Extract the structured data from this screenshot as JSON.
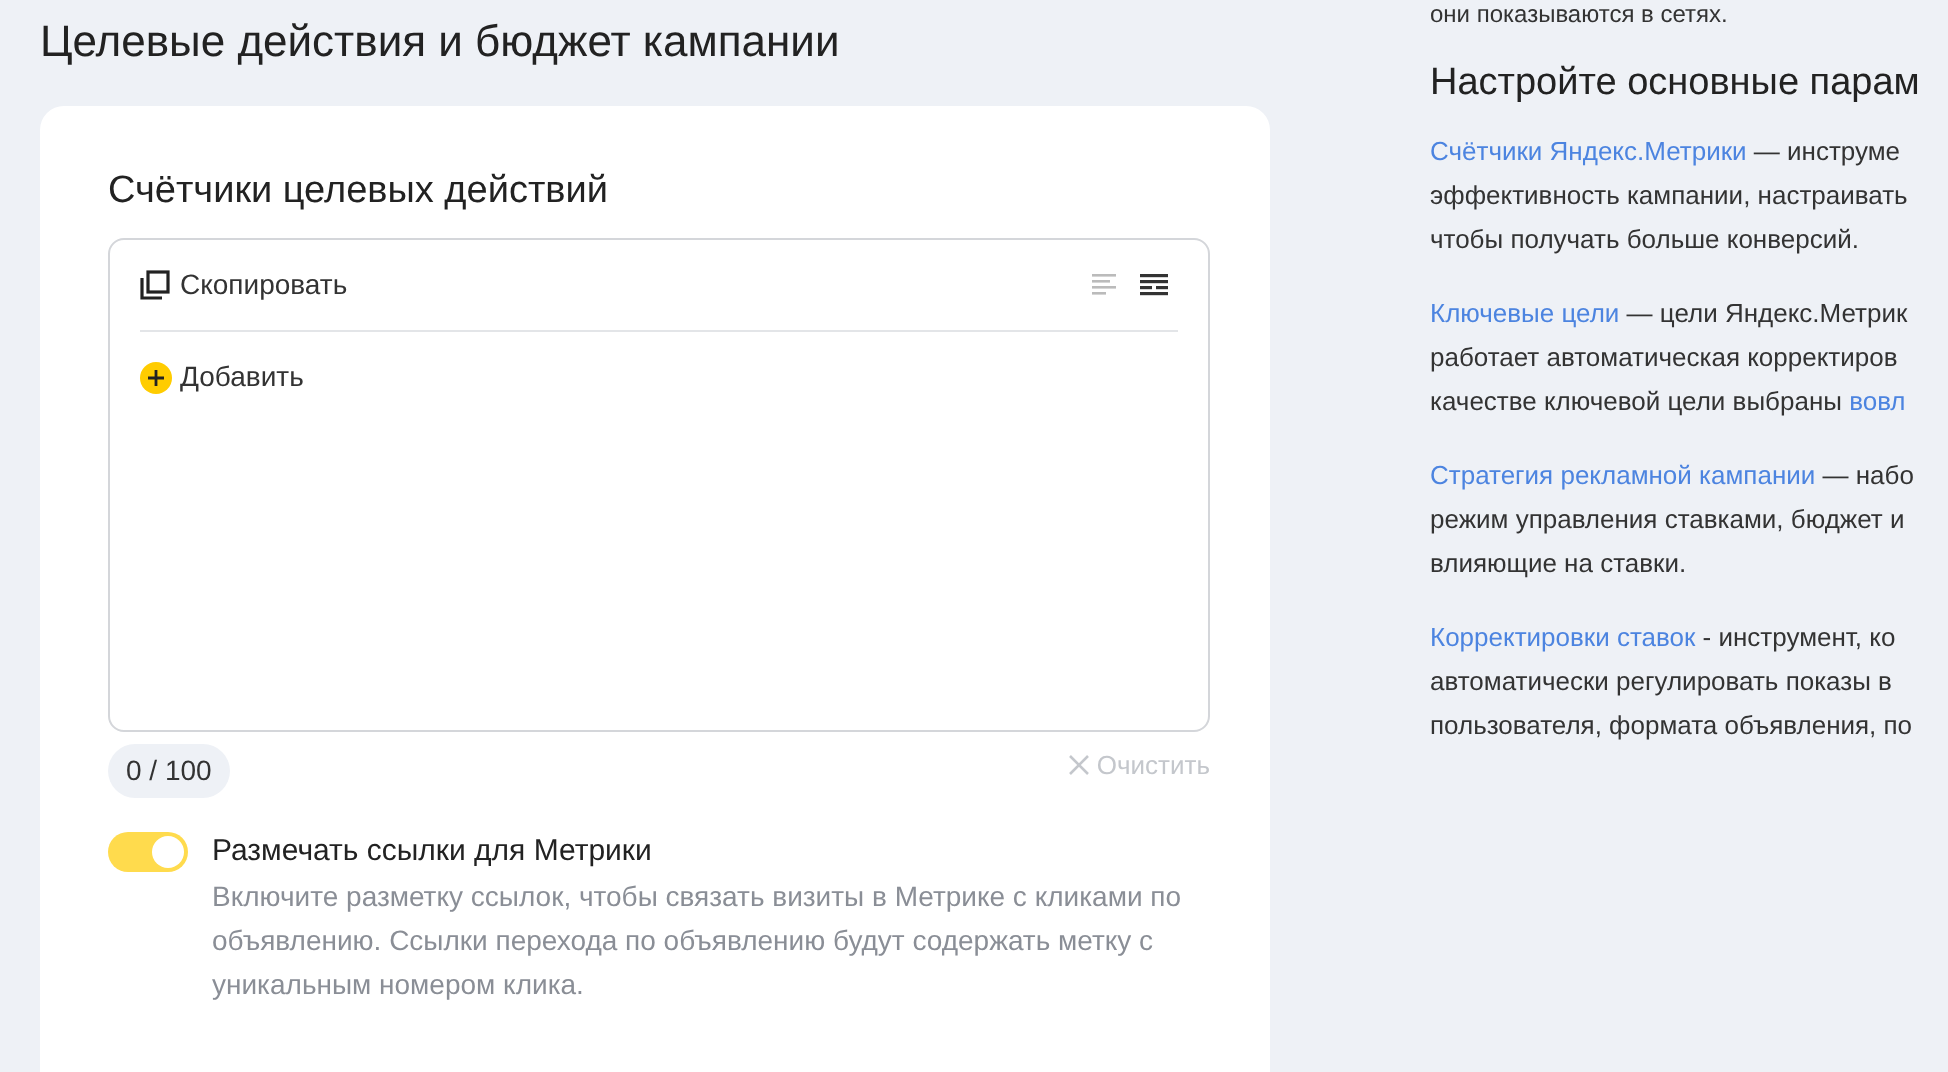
{
  "page_title": "Целевые действия и бюджет кампании",
  "card": {
    "title": "Счётчики целевых действий",
    "editor": {
      "copy_button": "Скопировать",
      "add_button": "Добавить",
      "view_buttons": [
        {
          "kind": "plain",
          "selected": false
        },
        {
          "kind": "grouped",
          "selected": true
        }
      ]
    },
    "counter": "0 / 100",
    "clear_button": "Очистить",
    "toggle": {
      "on": true,
      "label": "Размечать ссылки для Метрики",
      "description": "Включите разметку ссылок, чтобы связать визиты в Метрике с кликами по объявлению. Ссылки перехода по объявлению будут содержать метку с уникальным номером клика."
    }
  },
  "help": {
    "top_line": "они показываются в сетях.",
    "title": "Настройте основные парам",
    "paragraphs": [
      {
        "lines": [
          [
            {
              "text": "Счётчики Яндекс.Метрики",
              "link": true
            },
            {
              "text": " — инструме",
              "link": false
            }
          ],
          [
            {
              "text": "эффективность кампании, настраивать",
              "link": false
            }
          ],
          [
            {
              "text": "чтобы получать больше конверсий.",
              "link": false
            }
          ]
        ]
      },
      {
        "lines": [
          [
            {
              "text": "Ключевые цели",
              "link": true
            },
            {
              "text": " — цели Яндекс.Метрик",
              "link": false
            }
          ],
          [
            {
              "text": "работает автоматическая корректиров",
              "link": false
            }
          ],
          [
            {
              "text": "качестве ключевой цели выбраны ",
              "link": false
            },
            {
              "text": "вовл",
              "link": true
            }
          ]
        ]
      },
      {
        "lines": [
          [
            {
              "text": "Стратегия рекламной кампании",
              "link": true
            },
            {
              "text": " — набо",
              "link": false
            }
          ],
          [
            {
              "text": "режим управления ставками, бюджет и",
              "link": false
            }
          ],
          [
            {
              "text": "влияющие на ставки.",
              "link": false
            }
          ]
        ]
      },
      {
        "lines": [
          [
            {
              "text": "Корректировки ставок",
              "link": true
            },
            {
              "text": " - инструмент, ко",
              "link": false
            }
          ],
          [
            {
              "text": "автоматически регулировать показы в",
              "link": false
            }
          ],
          [
            {
              "text": "пользователя, формата объявления, по",
              "link": false
            }
          ]
        ]
      }
    ]
  }
}
